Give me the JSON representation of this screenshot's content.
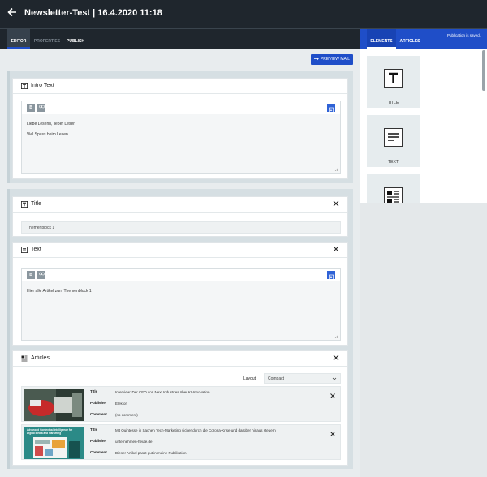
{
  "header": {
    "title": "Newsletter-Test | 16.4.2020 11:18"
  },
  "tabs": [
    {
      "label": "Editor"
    },
    {
      "label": "Properties"
    },
    {
      "label": "Publish"
    }
  ],
  "right_tabs": [
    {
      "label": "Elements"
    },
    {
      "label": "Articles"
    }
  ],
  "save_status": "Publication is saved.",
  "preview_button": "PREVIEW MAIL",
  "intro": {
    "title": "Intro Text",
    "bold": "B",
    "link": "🔗",
    "lines": [
      "Liebe Leserin, lieber Leser",
      "Viel Spass beim Lesen."
    ]
  },
  "title_block": {
    "title": "Title",
    "value": "Themenblock 1"
  },
  "text_block": {
    "title": "Text",
    "bold": "B",
    "link": "🔗",
    "body": "Hier alle Artikel zum Themenblock 1"
  },
  "articles_block": {
    "title": "Articles",
    "layout_label": "Layout",
    "layout_value": "Compact",
    "labels": {
      "title": "Title",
      "publisher": "Publisher",
      "comment": "Comment"
    },
    "items": [
      {
        "title": "Interview: Der CEO von Next Industries über KI-Innovation",
        "publisher": "Elektor",
        "comment": "(no comment)",
        "thumb_text": ""
      },
      {
        "title": "Mit Quintesse in Sachen Tech-Marketing sicher durch die Corona-Krise und darüber hinaus steuern",
        "publisher": "unternehmen-heute.de",
        "comment": "Dieser Artikel passt gut in meine Publikation.",
        "thumb_text": "Advanced Contextual Intelligence for Digital Media and Marketing"
      }
    ]
  },
  "elements": [
    {
      "label": "Title"
    },
    {
      "label": "Text"
    },
    {
      "label": ""
    }
  ]
}
